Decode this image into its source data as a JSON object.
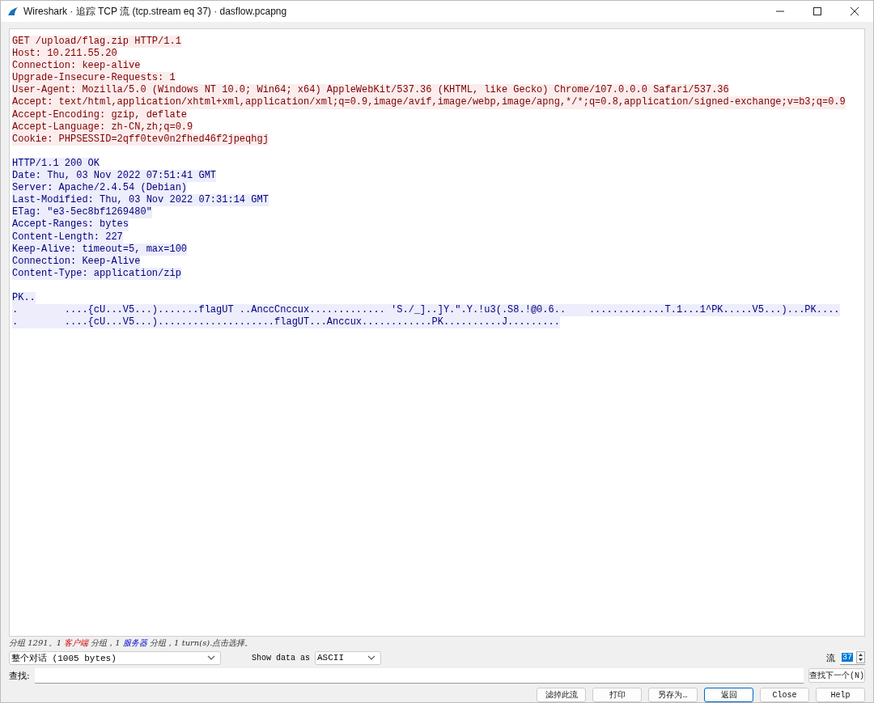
{
  "window": {
    "title": "Wireshark · 追踪 TCP 流 (tcp.stream eq 37) · dasflow.pcapng"
  },
  "stream": [
    {
      "kind": "client",
      "text": "GET /upload/flag.zip HTTP/1.1"
    },
    {
      "kind": "client",
      "text": "Host: 10.211.55.20"
    },
    {
      "kind": "client",
      "text": "Connection: keep-alive"
    },
    {
      "kind": "client",
      "text": "Upgrade-Insecure-Requests: 1"
    },
    {
      "kind": "client",
      "text": "User-Agent: Mozilla/5.0 (Windows NT 10.0; Win64; x64) AppleWebKit/537.36 (KHTML, like Gecko) Chrome/107.0.0.0 Safari/537.36"
    },
    {
      "kind": "client",
      "text": "Accept: text/html,application/xhtml+xml,application/xml;q=0.9,image/avif,image/webp,image/apng,*/*;q=0.8,application/signed-exchange;v=b3;q=0.9"
    },
    {
      "kind": "client",
      "text": "Accept-Encoding: gzip, deflate"
    },
    {
      "kind": "client",
      "text": "Accept-Language: zh-CN,zh;q=0.9"
    },
    {
      "kind": "client",
      "text": "Cookie: PHPSESSID=2qff0tev0n2fhed46f2jpeqhgj"
    },
    {
      "kind": "blank"
    },
    {
      "kind": "server",
      "text": "HTTP/1.1 200 OK"
    },
    {
      "kind": "server",
      "text": "Date: Thu, 03 Nov 2022 07:51:41 GMT"
    },
    {
      "kind": "server",
      "text": "Server: Apache/2.4.54 (Debian)"
    },
    {
      "kind": "server",
      "text": "Last-Modified: Thu, 03 Nov 2022 07:31:14 GMT"
    },
    {
      "kind": "server",
      "text": "ETag: \"e3-5ec8bf1269480\""
    },
    {
      "kind": "server",
      "text": "Accept-Ranges: bytes"
    },
    {
      "kind": "server",
      "text": "Content-Length: 227"
    },
    {
      "kind": "server",
      "text": "Keep-Alive: timeout=5, max=100"
    },
    {
      "kind": "server",
      "text": "Connection: Keep-Alive"
    },
    {
      "kind": "server",
      "text": "Content-Type: application/zip"
    },
    {
      "kind": "blank"
    },
    {
      "kind": "server",
      "text": "PK.."
    },
    {
      "kind": "server",
      "text": ".        ....{cU...V5...).......flagUT ..AnccCnccux............. 'S./_]..]Y.\".Y.!u3(.S8.!@0.6..    .............T.1...1^PK.....V5...)...PK...."
    },
    {
      "kind": "server",
      "text": ".        ....{cU...V5...)....................flagUT...Anccux............PK..........J........."
    }
  ],
  "status": [
    {
      "kind": "plain",
      "text": "分组 1291。1 "
    },
    {
      "kind": "client",
      "text": "客户端"
    },
    {
      "kind": "plain",
      "text": " 分组，1 "
    },
    {
      "kind": "server",
      "text": "服务器"
    },
    {
      "kind": "plain",
      "text": " 分组，1 turn(s).点击选择。"
    }
  ],
  "conversation": {
    "value": "整个对话 (1005 bytes)"
  },
  "show_data_as": {
    "label": "Show data as",
    "value": "ASCII"
  },
  "stream_number": {
    "label": "流",
    "value": "37"
  },
  "find": {
    "label": "查找:",
    "button": "查找下一个(N)"
  },
  "buttons": [
    {
      "label": "滤掉此流",
      "default": false
    },
    {
      "label": "打印",
      "default": false
    },
    {
      "label": "另存为…",
      "default": false
    },
    {
      "label": "返回",
      "default": true
    },
    {
      "label": "Close",
      "default": false
    },
    {
      "label": "Help",
      "default": false
    }
  ]
}
